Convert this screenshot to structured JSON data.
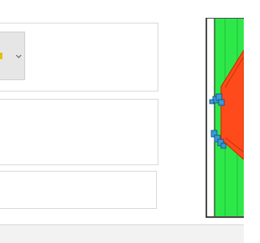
{
  "panels": {
    "top": {
      "dropdown": {
        "selected_icon": "part-color-icon",
        "swatch_color": "#e0c000",
        "arrow_icon": "chevron-down-icon"
      }
    },
    "middle": {},
    "bottom": {}
  },
  "viewer": {
    "colors": {
      "frame": "#111111",
      "green": "#2ee84a",
      "green_stripe": "#1dbf38",
      "plate": "#ff4b1c",
      "plate_edge": "#c22a00",
      "bolt": "#3a9ad6",
      "bolt_edge": "#0b4b7a"
    }
  },
  "status_bar": {}
}
